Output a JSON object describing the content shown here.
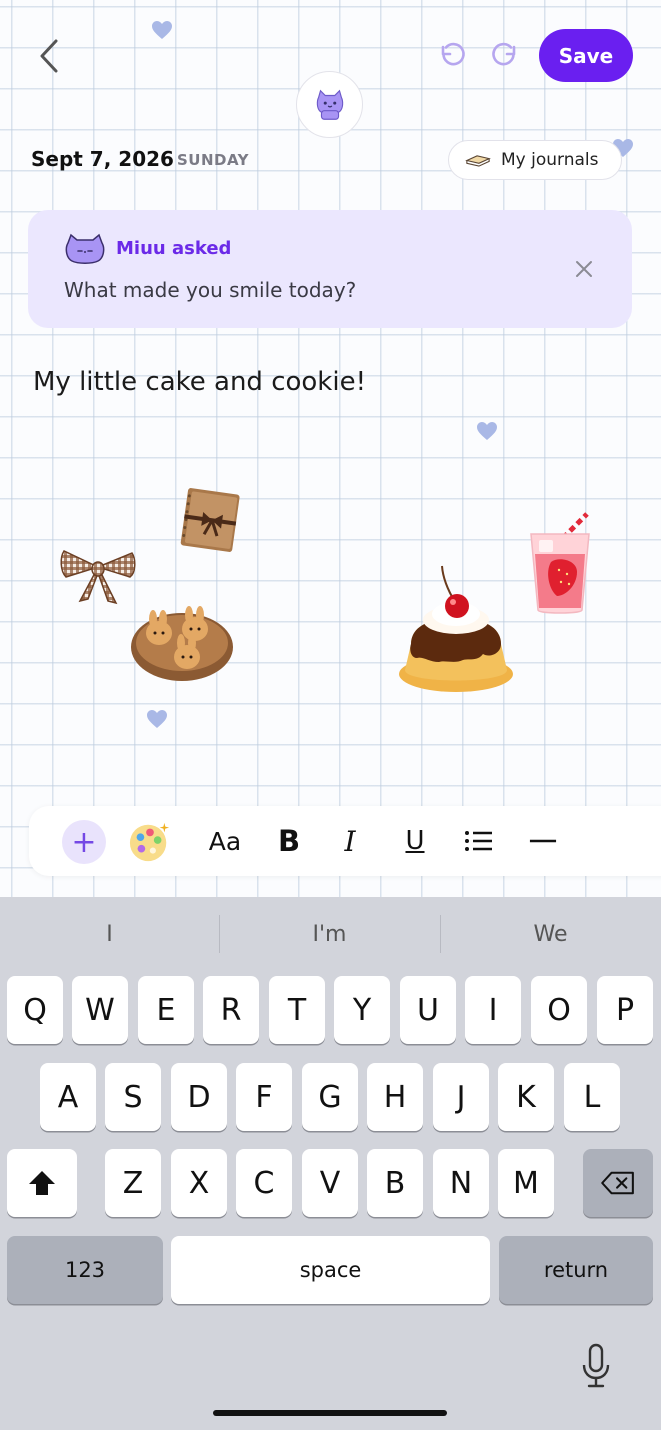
{
  "header": {
    "back_icon": "chevron-left-icon",
    "undo_icon": "undo-icon",
    "redo_icon": "redo-icon",
    "save_label": "Save",
    "accent_color": "#6a1ff0"
  },
  "entry_meta": {
    "date": "Sept 7, 2026",
    "weekday": "SUNDAY",
    "journals_label": "My journals"
  },
  "prompt": {
    "asker": "Miuu asked",
    "question": "What made you smile today?",
    "close_icon": "close-icon",
    "background": "#ebe7fe"
  },
  "entry": {
    "text": "My little cake and cookie!",
    "stickers": [
      "notebook-sticker",
      "bow-sticker",
      "bunny-cookies-sticker",
      "pudding-sticker",
      "strawberry-drink-sticker"
    ]
  },
  "toolbar": {
    "add": "+",
    "palette_icon": "palette-icon",
    "font_label": "Aa",
    "bold": "B",
    "italic": "I",
    "underline": "U",
    "list_icon": "list-icon",
    "divider_icon": "divider-icon"
  },
  "keyboard": {
    "suggestions": [
      "I",
      "I'm",
      "We"
    ],
    "row1": [
      "Q",
      "W",
      "E",
      "R",
      "T",
      "Y",
      "U",
      "I",
      "O",
      "P"
    ],
    "row2": [
      "A",
      "S",
      "D",
      "F",
      "G",
      "H",
      "J",
      "K",
      "L"
    ],
    "row3": [
      "Z",
      "X",
      "C",
      "V",
      "B",
      "N",
      "M"
    ],
    "numbers_label": "123",
    "space_label": "space",
    "return_label": "return",
    "shift_icon": "shift-icon",
    "backspace_icon": "backspace-icon",
    "mic_icon": "microphone-icon"
  }
}
